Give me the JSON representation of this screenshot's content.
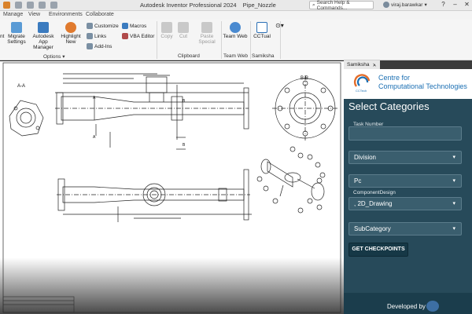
{
  "titlebar": {
    "app_name": "Autodesk Inventor Professional 2024",
    "doc_name": "Pipe_Nozzle",
    "search_placeholder": "Search Help & Commands...",
    "user": "viraj.barawkar"
  },
  "menubar": {
    "tabs": [
      "Manage",
      "View",
      "Environments",
      "Collaborate"
    ]
  },
  "ribbon": {
    "migrate_settings": "Migrate Settings",
    "migrate_prefix": "nt",
    "app_manager": "Autodesk App Manager",
    "highlight_new": "Highlight New",
    "customize": "Customize",
    "links": "Links",
    "add_ins": "Add-Ins",
    "macros": "Macros",
    "vba_editor": "VBA Editor",
    "options_label": "Options",
    "copy": "Copy",
    "cut": "Cut",
    "paste_special": "Paste Special",
    "clipboard_label": "Clipboard",
    "team_web": "Team Web",
    "team_web_label": "Team Web",
    "samiksha_label": "Samiksha",
    "cctual": "CCTual"
  },
  "drawing": {
    "view_a": "A-A",
    "view_b": "B-B"
  },
  "panel": {
    "browser_tab": "Samiksha",
    "logo_line1": "Centre for",
    "logo_line2": "Computational Technologies",
    "logo_caption": "CCTech",
    "title": "Select Categories",
    "task_number_label": "Task Number",
    "task_number_value": "",
    "division": "Division",
    "pc": "Pc",
    "component_design_label": "ComponentDesign",
    "component_design_value": ", 2D_Drawing",
    "subcategory": "SubCategory",
    "get_checkpoints": "GET CHECKPOINTS",
    "developed_by": "Developed by"
  }
}
